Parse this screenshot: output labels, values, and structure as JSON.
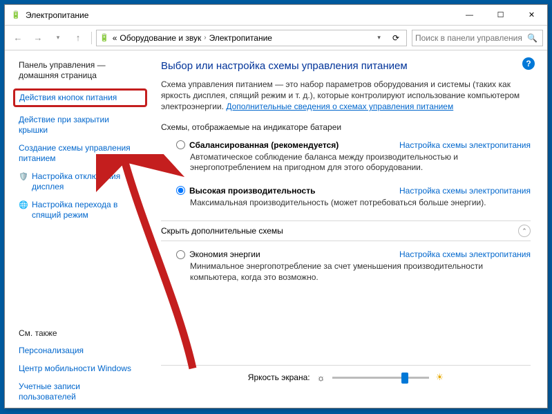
{
  "window": {
    "title": "Электропитание"
  },
  "nav": {
    "breadcrumb_prefix": "«",
    "breadcrumb1": "Оборудование и звук",
    "breadcrumb2": "Электропитание",
    "search_placeholder": "Поиск в панели управления"
  },
  "sidebar": {
    "home_line1": "Панель управления —",
    "home_line2": "домашняя страница",
    "link_power_buttons": "Действия кнопок питания",
    "link_lid_close_line1": "Действие при закрытии",
    "link_lid_close_line2": "крышки",
    "link_create_plan_line1": "Создание схемы управления",
    "link_create_plan_line2": "питанием",
    "link_display_off_line1": "Настройка отключения",
    "link_display_off_line2": "дисплея",
    "link_sleep_line1": "Настройка перехода в",
    "link_sleep_line2": "спящий режим",
    "see_also": "См. также",
    "link_personalization": "Персонализация",
    "link_mobility_center": "Центр мобильности Windows",
    "link_user_accounts_line1": "Учетные записи",
    "link_user_accounts_line2": "пользователей"
  },
  "main": {
    "heading": "Выбор или настройка схемы управления питанием",
    "intro_part1": "Схема управления питанием — это набор параметров оборудования и системы (таких как яркость дисплея, спящий режим и т. д.), которые контролируют использование компьютером электроэнергии. ",
    "intro_link": "Дополнительные сведения о схемах управления питанием",
    "section_battery": "Схемы, отображаемые на индикаторе батареи",
    "plan_balanced_label": "Сбалансированная (рекомендуется)",
    "plan_balanced_desc": "Автоматическое соблюдение баланса между производительностью и энергопотреблением на пригодном для этого оборудовании.",
    "plan_high_label": "Высокая производительность",
    "plan_high_desc": "Максимальная производительность (может потребоваться больше энергии).",
    "plan_settings_link": "Настройка схемы электропитания",
    "hidden_section": "Скрыть дополнительные схемы",
    "plan_eco_label": "Экономия энергии",
    "plan_eco_desc": "Минимальное энергопотребление за счет уменьшения производительности компьютера, когда это возможно.",
    "brightness_label": "Яркость экрана:"
  }
}
